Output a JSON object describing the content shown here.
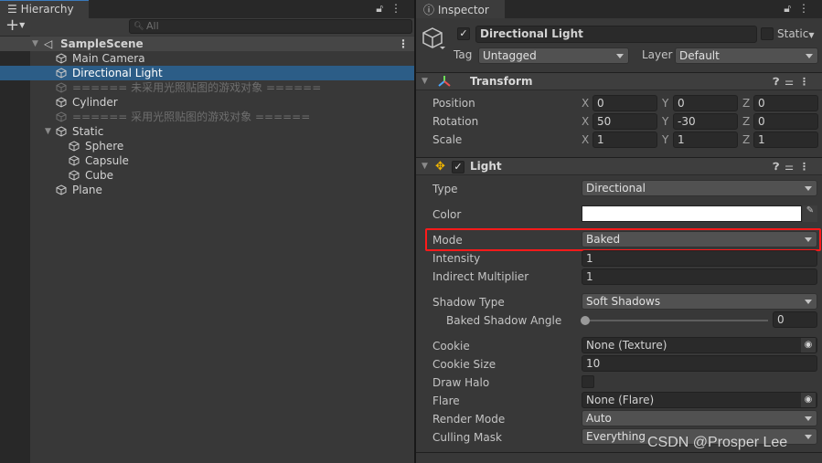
{
  "hierarchy": {
    "tab_label": "Hierarchy",
    "add_label": "+",
    "search_placeholder": "All",
    "scene": "SampleScene",
    "items": [
      {
        "label": "Main Camera",
        "depth": 1
      },
      {
        "label": "Directional Light",
        "depth": 1,
        "selected": true
      },
      {
        "label": "====== 未采用光照贴图的游戏对象 ======",
        "depth": 1,
        "disabled": true
      },
      {
        "label": "Cylinder",
        "depth": 1
      },
      {
        "label": "====== 采用光照贴图的游戏对象 ======",
        "depth": 1,
        "disabled": true
      },
      {
        "label": "Static",
        "depth": 1,
        "expanded": true
      },
      {
        "label": "Sphere",
        "depth": 2
      },
      {
        "label": "Capsule",
        "depth": 2
      },
      {
        "label": "Cube",
        "depth": 2
      },
      {
        "label": "Plane",
        "depth": 1
      }
    ]
  },
  "inspector": {
    "tab_label": "Inspector",
    "object_name": "Directional Light",
    "active": true,
    "static_label": "Static",
    "static": false,
    "tag_label": "Tag",
    "tag_value": "Untagged",
    "layer_label": "Layer",
    "layer_value": "Default",
    "transform": {
      "title": "Transform",
      "position_label": "Position",
      "position": [
        "0",
        "0",
        "0"
      ],
      "rotation_label": "Rotation",
      "rotation": [
        "50",
        "-30",
        "0"
      ],
      "scale_label": "Scale",
      "scale": [
        "1",
        "1",
        "1"
      ],
      "axes": [
        "X",
        "Y",
        "Z"
      ]
    },
    "light": {
      "title": "Light",
      "enabled": true,
      "type_label": "Type",
      "type": "Directional",
      "color_label": "Color",
      "color": "#ffffff",
      "mode_label": "Mode",
      "mode": "Baked",
      "intensity_label": "Intensity",
      "intensity": "1",
      "indirect_label": "Indirect Multiplier",
      "indirect": "1",
      "shadow_type_label": "Shadow Type",
      "shadow_type": "Soft Shadows",
      "baked_angle_label": "Baked Shadow Angle",
      "baked_angle": "0",
      "cookie_label": "Cookie",
      "cookie": "None (Texture)",
      "cookie_size_label": "Cookie Size",
      "cookie_size": "10",
      "draw_halo_label": "Draw Halo",
      "draw_halo": false,
      "flare_label": "Flare",
      "flare": "None (Flare)",
      "render_mode_label": "Render Mode",
      "render_mode": "Auto",
      "culling_mask_label": "Culling Mask",
      "culling_mask": "Everything"
    }
  },
  "highlight_color": "#ff1a1a",
  "watermark": "CSDN @Prosper Lee"
}
